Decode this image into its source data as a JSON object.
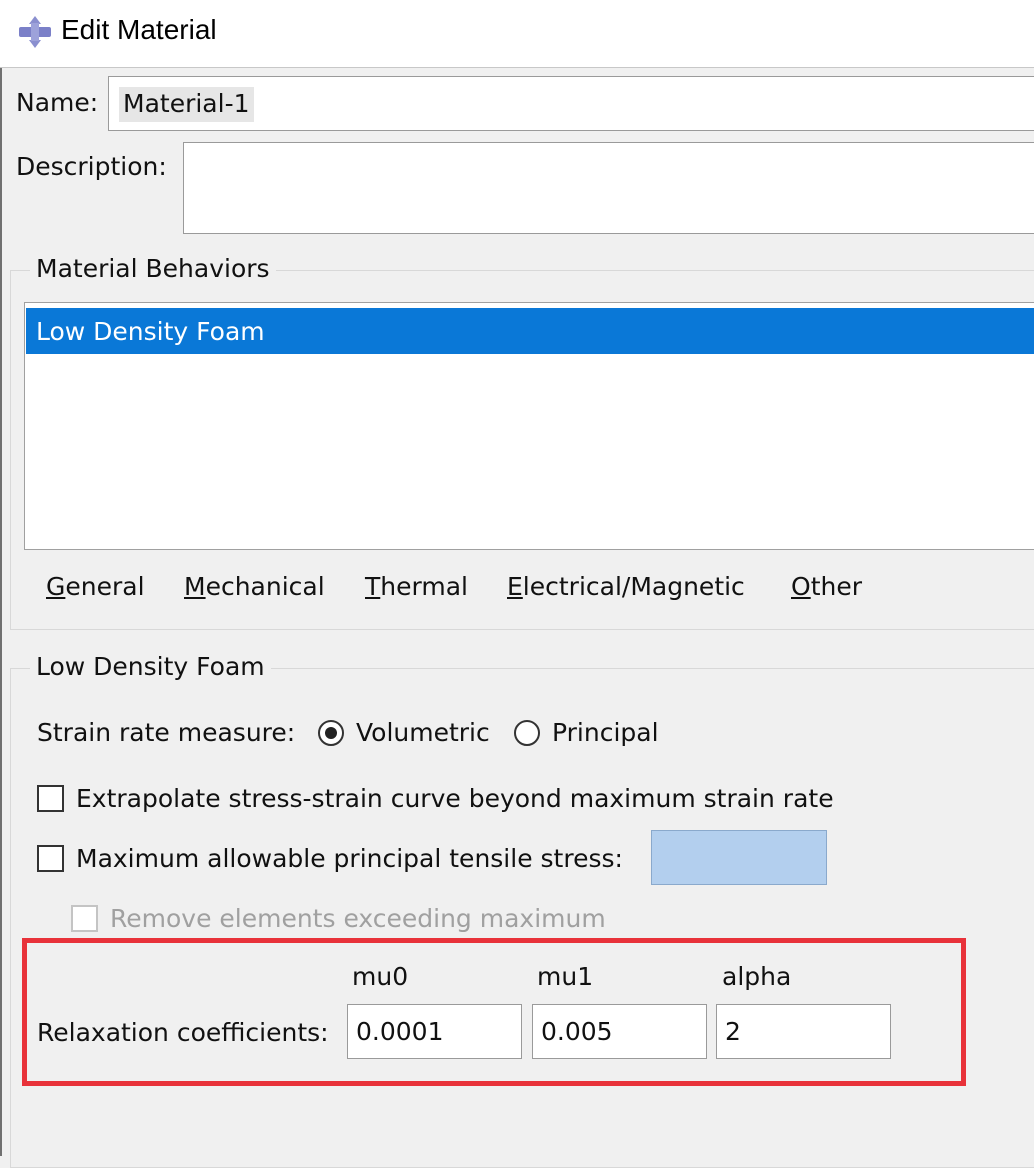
{
  "window": {
    "title": "Edit Material",
    "icon": "abaqus-material-icon"
  },
  "name": {
    "label": "Name:",
    "value": "Material-1"
  },
  "description": {
    "label": "Description:",
    "value": ""
  },
  "material_behaviors": {
    "title": "Material Behaviors",
    "items": [
      "Low Density Foam"
    ],
    "selected": "Low Density Foam"
  },
  "menu": {
    "items": [
      {
        "mnemonic": "G",
        "rest": "eneral"
      },
      {
        "mnemonic": "M",
        "rest": "echanical"
      },
      {
        "mnemonic": "T",
        "rest": "hermal"
      },
      {
        "mnemonic": "E",
        "rest": "lectrical/Magnetic"
      },
      {
        "mnemonic": "O",
        "rest": "ther"
      }
    ]
  },
  "foam_panel": {
    "title": "Low Density Foam",
    "strain_rate": {
      "label": "Strain rate measure:",
      "options": [
        "Volumetric",
        "Principal"
      ],
      "selected": "Volumetric"
    },
    "extrapolate": {
      "label": "Extrapolate stress-strain curve beyond maximum strain rate",
      "checked": false
    },
    "max_tensile": {
      "label": "Maximum allowable principal tensile stress:",
      "checked": false,
      "value": ""
    },
    "remove_elements": {
      "label": "Remove elements exceeding maximum",
      "checked": false,
      "enabled": false
    },
    "relaxation": {
      "label": "Relaxation coefficients:",
      "columns": [
        "mu0",
        "mu1",
        "alpha"
      ],
      "values": [
        "0.0001",
        "0.005",
        "2"
      ]
    }
  },
  "colors": {
    "selection": "#0a78d7",
    "highlight_border": "#e8323a",
    "input_highlight": "#b3cfee"
  }
}
